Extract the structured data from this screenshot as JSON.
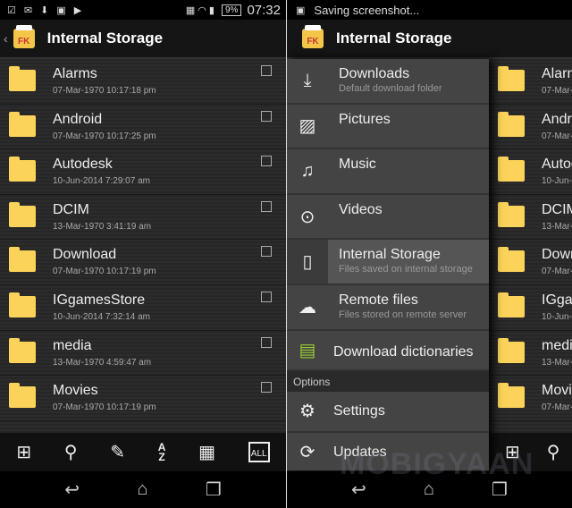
{
  "left": {
    "status": {
      "icons": [
        "checkbox-icon",
        "gmail-icon",
        "download-icon",
        "picture-icon",
        "play-store-icon"
      ],
      "battery": "9%",
      "time": "07:32"
    }
  },
  "right": {
    "status": {
      "text": "Saving screenshot..."
    }
  },
  "header": {
    "title": "Internal Storage",
    "logo": "FK"
  },
  "files": [
    {
      "name": "Alarms",
      "date": "07-Mar-1970 10:17:18 pm"
    },
    {
      "name": "Android",
      "date": "07-Mar-1970 10:17:25 pm"
    },
    {
      "name": "Autodesk",
      "date": "10-Jun-2014 7:29:07 am"
    },
    {
      "name": "DCIM",
      "date": "13-Mar-1970 3:41:19 am"
    },
    {
      "name": "Download",
      "date": "07-Mar-1970 10:17:19 pm"
    },
    {
      "name": "IGgamesStore",
      "date": "10-Jun-2014 7:32:14 am"
    },
    {
      "name": "media",
      "date": "13-Mar-1970 4:59:47 am"
    },
    {
      "name": "Movies",
      "date": "07-Mar-1970 10:17:19 pm"
    }
  ],
  "toolbar": [
    "new-file-icon",
    "search-icon",
    "edit-icon",
    "sort-az-icon",
    "grid-icon",
    "select-all-icon"
  ],
  "drawer": {
    "items": [
      {
        "label": "Downloads",
        "sub": "Default download folder",
        "icon": "download-icon"
      },
      {
        "label": "Pictures",
        "sub": "",
        "icon": "picture-icon"
      },
      {
        "label": "Music",
        "sub": "",
        "icon": "music-icon"
      },
      {
        "label": "Videos",
        "sub": "",
        "icon": "play-icon"
      },
      {
        "label": "Internal Storage",
        "sub": "Files saved on internal storage",
        "icon": "tablet-icon",
        "selected": true
      },
      {
        "label": "Remote files",
        "sub": "Files stored on remote server",
        "icon": "cloud-icon"
      },
      {
        "label": "Download dictionaries",
        "sub": "",
        "icon": "dictionary-icon"
      }
    ],
    "options_header": "Options",
    "options": [
      {
        "label": "Settings",
        "icon": "gear-icon"
      },
      {
        "label": "Updates",
        "icon": "refresh-icon"
      }
    ]
  },
  "watermark": "MOBIGYAAN"
}
